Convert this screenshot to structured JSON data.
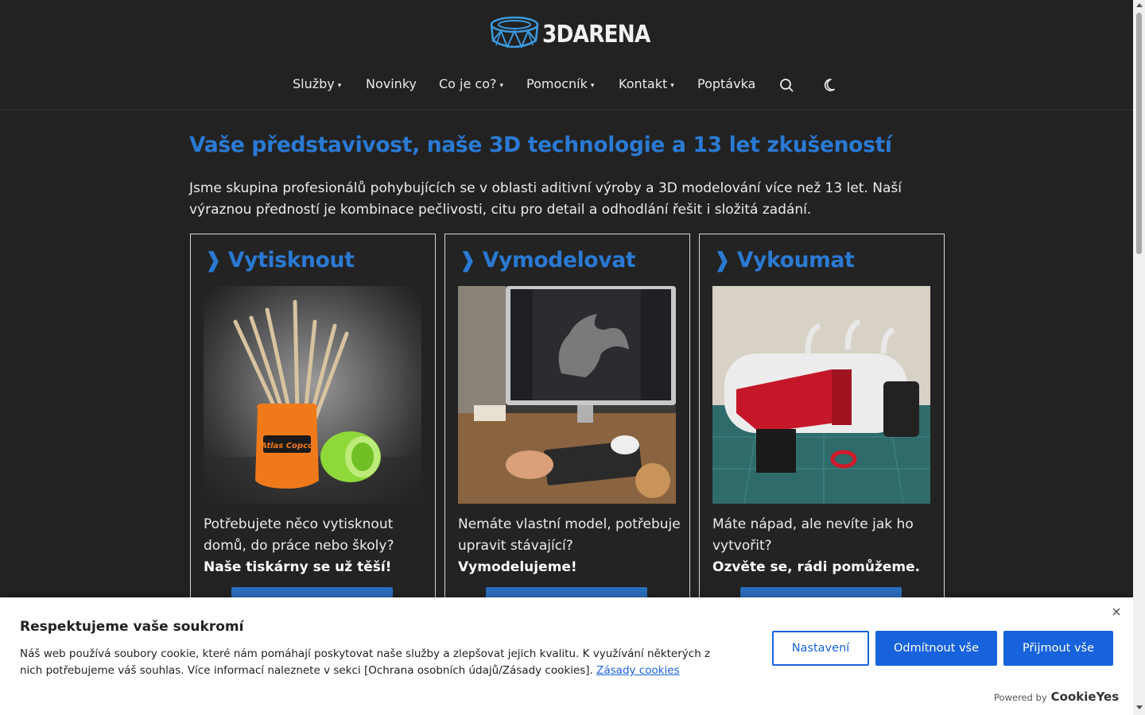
{
  "header": {
    "logo_text": "3DARENA",
    "nav": [
      {
        "label": "Služby",
        "dropdown": true
      },
      {
        "label": "Novinky",
        "dropdown": false
      },
      {
        "label": "Co je co?",
        "dropdown": true
      },
      {
        "label": "Pomocník",
        "dropdown": true
      },
      {
        "label": "Kontakt",
        "dropdown": true
      },
      {
        "label": "Poptávka",
        "dropdown": false
      }
    ],
    "caret": "▾",
    "icons": [
      "search-icon",
      "moon-icon"
    ]
  },
  "hero": {
    "title": "Vaše představivost, naše 3D technologie a 13 let zkušeností",
    "text": "Jsme skupina profesionálů pohybujících se v oblasti aditivní výroby a 3D modelování více než 13 let. Naší výraznou předností je kombinace pečlivosti, citu pro detail a odhodlání řešit i složitá zadání."
  },
  "cards": [
    {
      "arrow": "❱",
      "title": "Vytisknout",
      "text": "Potřebujete něco vytisknout domů, do práce nebo školy?",
      "bold": "Naše tiskárny se už těší!"
    },
    {
      "arrow": "❱",
      "title": "Vymodelovat",
      "text": "Nemáte vlastní model, potřebuje upravit stávající?",
      "bold": "Vymodelujeme!"
    },
    {
      "arrow": "❱",
      "title": "Vykoumat",
      "text": "Máte nápad, ale nevíte jak ho vytvořit?",
      "bold": "Ozvěte se, rádi pomůžeme."
    }
  ],
  "cookie": {
    "title": "Respektujeme vaše soukromí",
    "text": "Náš web používá soubory cookie, které nám pomáhají poskytovat naše služby a zlepšovat jejich kvalitu. K využívání některých z nich potřebujeme váš souhlas. Více informací naleznete v sekci [Ochrana osobních údajů/Zásady cookies].",
    "link": "Zásady cookies",
    "btn_settings": "Nastavení",
    "btn_reject": "Odmítnout vše",
    "btn_accept": "Přijmout vše",
    "powered_by": "Powered by",
    "brand": "CookieYes"
  },
  "colors": {
    "background": "#222222",
    "accent_blue": "#2a7ad4",
    "cookie_blue": "#1863dc"
  }
}
